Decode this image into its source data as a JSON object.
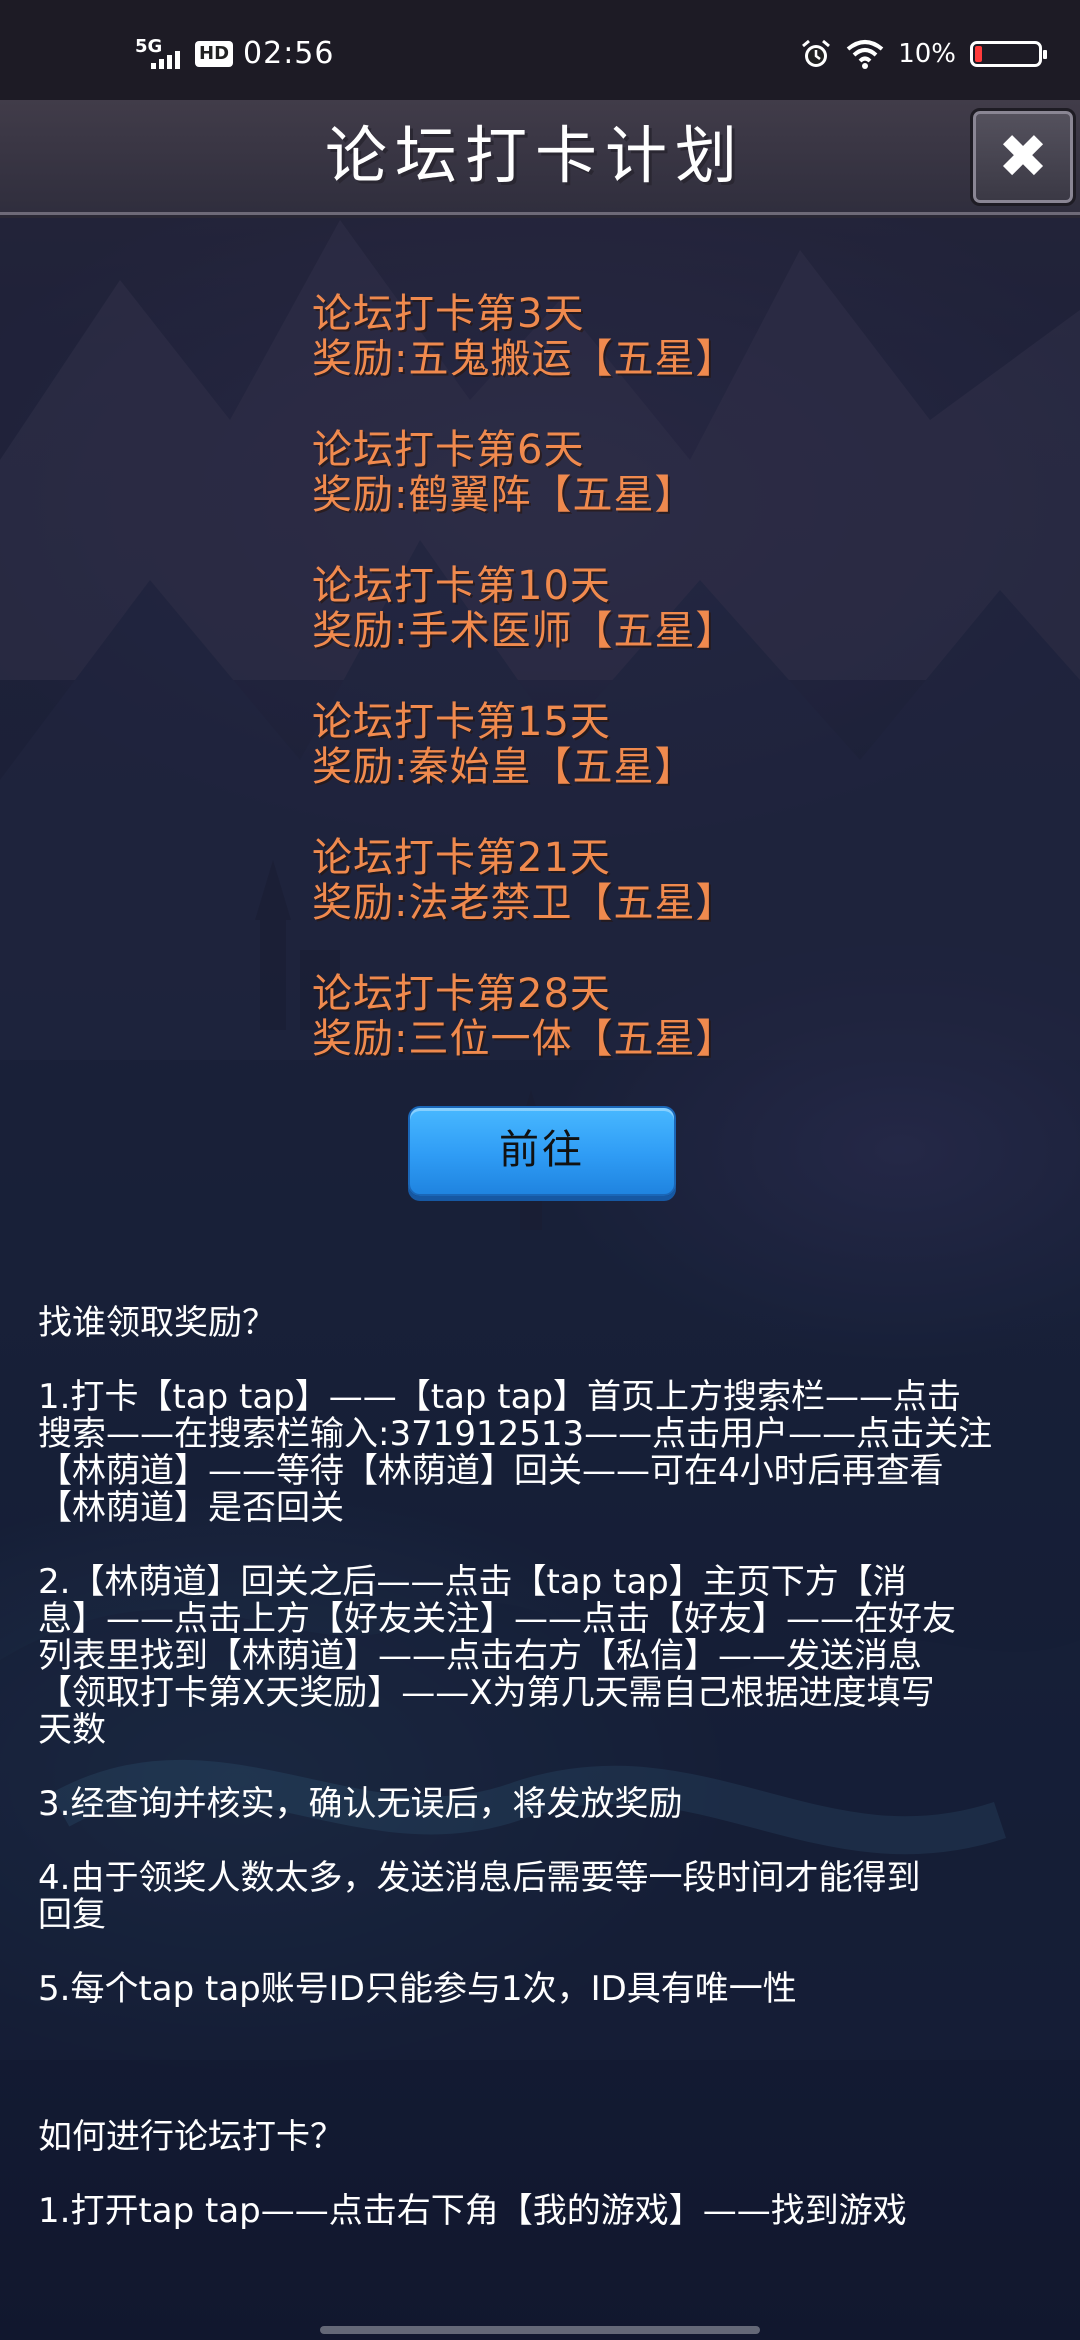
{
  "status_bar": {
    "network": "5G",
    "hd": "HD",
    "time": "02:56",
    "battery_percent": "10%",
    "battery_level": 0.1,
    "alarm_icon": "alarm-clock-icon",
    "wifi_icon": "wifi-icon"
  },
  "header": {
    "title": "论坛打卡计划",
    "close_icon": "close-icon"
  },
  "rewards": [
    {
      "day": "论坛打卡第3天",
      "reward": "奖励:五鬼搬运【五星】"
    },
    {
      "day": "论坛打卡第6天",
      "reward": "奖励:鹤翼阵【五星】"
    },
    {
      "day": "论坛打卡第10天",
      "reward": "奖励:手术医师【五星】"
    },
    {
      "day": "论坛打卡第15天",
      "reward": "奖励:秦始皇【五星】"
    },
    {
      "day": "论坛打卡第21天",
      "reward": "奖励:法老禁卫【五星】"
    },
    {
      "day": "论坛打卡第28天",
      "reward": "奖励:三位一体【五星】"
    }
  ],
  "go_button": "前往",
  "instructions": {
    "heading": "找谁领取奖励？",
    "steps": [
      "1.打卡【tap tap】——【tap tap】首页上方搜索栏——点击\n搜索——在搜索栏输入:371912513——点击用户——点击关注\n【林荫道】——等待【林荫道】回关——可在4小时后再查看\n【林荫道】是否回关",
      "2.【林荫道】回关之后——点击【tap tap】主页下方【消\n息】——点击上方【好友关注】——点击【好友】——在好友\n列表里找到【林荫道】——点击右方【私信】——发送消息\n【领取打卡第X天奖励】——X为第几天需自己根据进度填写\n天数",
      "3.经查询并核实，确认无误后，将发放奖励",
      "4.由于领奖人数太多，发送消息后需要等一段时间才能得到\n回复",
      "5.每个tap tap账号ID只能参与1次，ID具有唯一性"
    ],
    "heading2": "如何进行论坛打卡？",
    "partial_line": "1.打开tap tap——点击右下角【我的游戏】——找到游戏"
  },
  "colors": {
    "reward_text": "#f08a4e",
    "button_blue": "#2f9cf5",
    "text_white": "#ffffff"
  }
}
